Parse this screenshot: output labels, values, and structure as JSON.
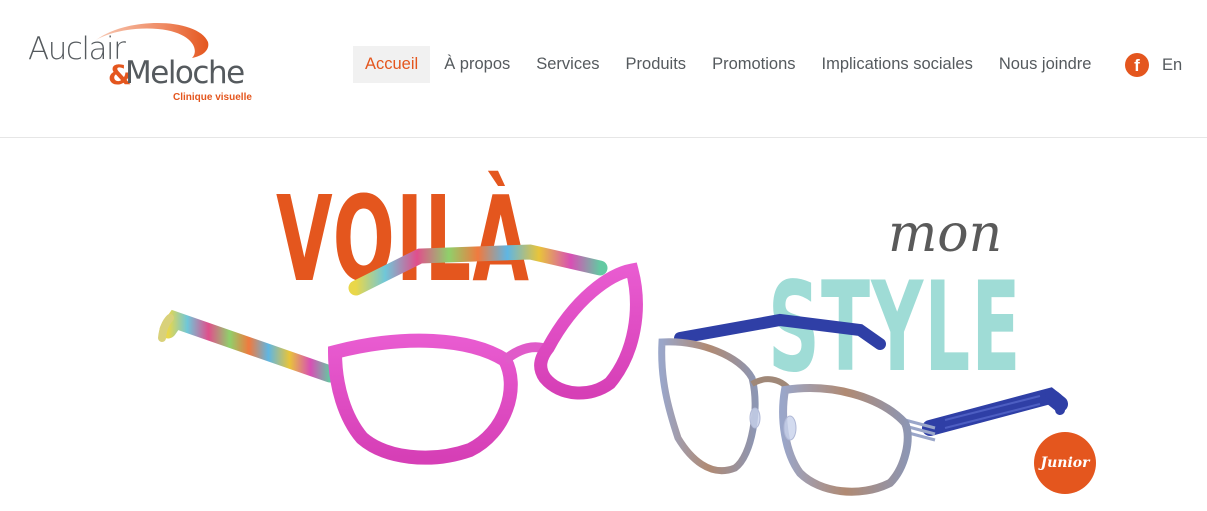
{
  "logo": {
    "word1": "Auclair",
    "amp": "&",
    "word2": "Meloche",
    "tagline": "Clinique visuelle"
  },
  "nav": {
    "items": [
      {
        "label": "Accueil",
        "active": true
      },
      {
        "label": "À propos",
        "active": false
      },
      {
        "label": "Services",
        "active": false
      },
      {
        "label": "Produits",
        "active": false
      },
      {
        "label": "Promotions",
        "active": false
      },
      {
        "label": "Implications sociales",
        "active": false
      },
      {
        "label": "Nous joindre",
        "active": false
      }
    ],
    "facebook_glyph": "f",
    "language": "En"
  },
  "hero": {
    "headline_left": "VOILÀ",
    "headline_right_small": "mon",
    "headline_right_big": "STYLE",
    "badge": "Junior"
  },
  "colors": {
    "accent": "#e4561e",
    "text": "#555a5e",
    "style_teal": "#9fdcd6",
    "pink_frame": "#e04fc6",
    "blue_temple": "#2f3fa6"
  },
  "icons": [
    "facebook-icon",
    "logo-swoosh"
  ]
}
